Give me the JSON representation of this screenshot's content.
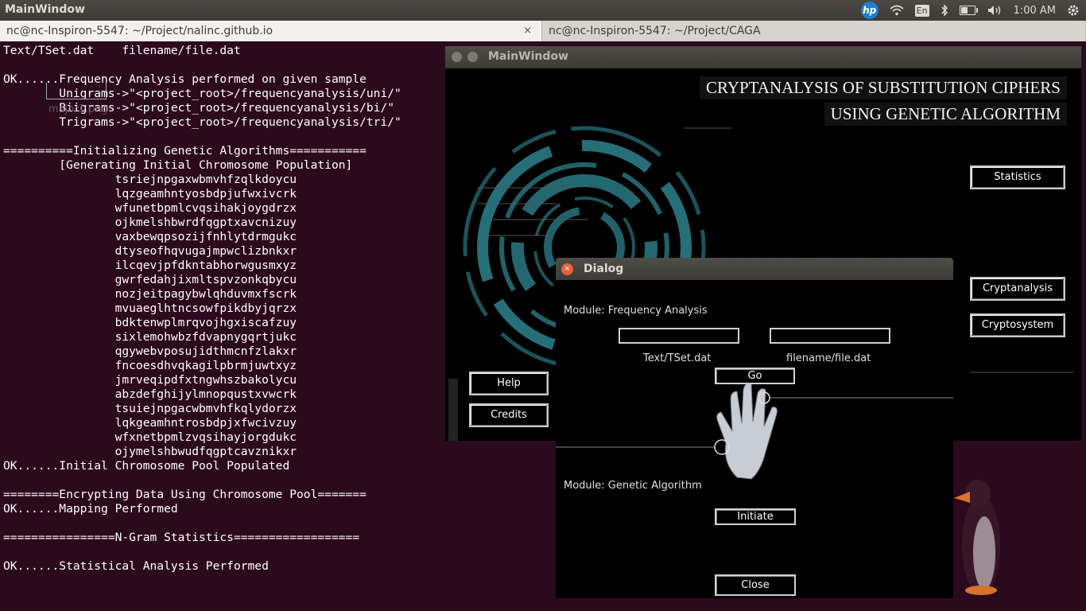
{
  "topbar": {
    "title": "MainWindow",
    "tray": {
      "vendor": "hp",
      "keyboard": "En",
      "clock": "1:00 AM",
      "battery_level": 0.55
    }
  },
  "tabs": [
    {
      "label": "nc@nc-Inspiron-5547: ~/Project/nalinc.github.io",
      "close": "×"
    },
    {
      "label": "nc@nc-Inspiron-5547: ~/Project/CAGA"
    }
  ],
  "terminal": {
    "file_hint": "major1.png",
    "lines": [
      "Text/TSet.dat    filename/file.dat",
      "",
      "OK......Frequency Analysis performed on given sample",
      "        Unigrams->\"<project_root>/frequencyanalysis/uni/\"",
      "        Biigrams->\"<project_root>/frequencyanalysis/bi/\"",
      "        Trigrams->\"<project_root>/frequencyanalysis/tri/\"",
      "",
      "==========Initializing Genetic Algorithms===========",
      "        [Generating Initial Chromosome Population]",
      "                tsriejnpgaxwbmvhfzqlkdoycu",
      "                lqzgeamhntyosbdpjufwxivcrk",
      "                wfunetbpmlcvqsihakjoygdrzx",
      "                ojkmelshbwrdfqgptxavcnizuy",
      "                vaxbewqpsozijfnhlytdrmgukc",
      "                dtyseofhqvugajmpwclizbnkxr",
      "                ilcqevjpfdkntabhorwgusmxyz",
      "                gwrfedahjixmltspvzonkqbycu",
      "                nozjeitpagybwlqhduvmxfscrk",
      "                mvuaeglhtncsowfpikdbyjqrzx",
      "                bdktenwplmrqvojhgxiscafzuy",
      "                sixlemohwbzfdvapnygqrtjukc",
      "                qgywebvposujidthmcnfzlakxr",
      "                fncoesdhvqkagilpbrmjuwtxyz",
      "                jmrveqipdfxtngwhszbakolycu",
      "                abzdefghijylmnopqustxvwcrk",
      "                tsuiejnpgacwbmvhfkqlydorzx",
      "                lqkgeamhntrosbdpjxfwcivzuy",
      "                wfxnetbpmlzvqsihayjorgdukc",
      "                ojymelshbwudfqgptcavznikxr",
      "OK......Initial Chromosome Pool Populated",
      "",
      "========Encrypting Data Using Chromosome Pool=======",
      "OK......Mapping Performed",
      "",
      "================N-Gram Statistics==================",
      "",
      "OK......Statistical Analysis Performed"
    ]
  },
  "mainwindow": {
    "title": "MainWindow",
    "banner_line1": "CRYPTANALYSIS OF SUBSTITUTION CIPHERS",
    "banner_line2": "USING GENETIC ALGORITHM",
    "buttons": {
      "statistics": "Statistics",
      "cryptanalysis": "Cryptanalysis",
      "cryptosystem": "Cryptosystem",
      "help": "Help",
      "credits": "Credits"
    }
  },
  "dialog": {
    "title": "Dialog",
    "close_glyph": "×",
    "module1_label": "Module: Frequency Analysis",
    "input1_value": "",
    "input2_value": "",
    "input1_caption": "Text/TSet.dat",
    "input2_caption": "filename/file.dat",
    "go_button": "Go",
    "module2_label": "Module: Genetic Algorithm",
    "initiate_button": "Initiate",
    "close_button": "Close"
  }
}
